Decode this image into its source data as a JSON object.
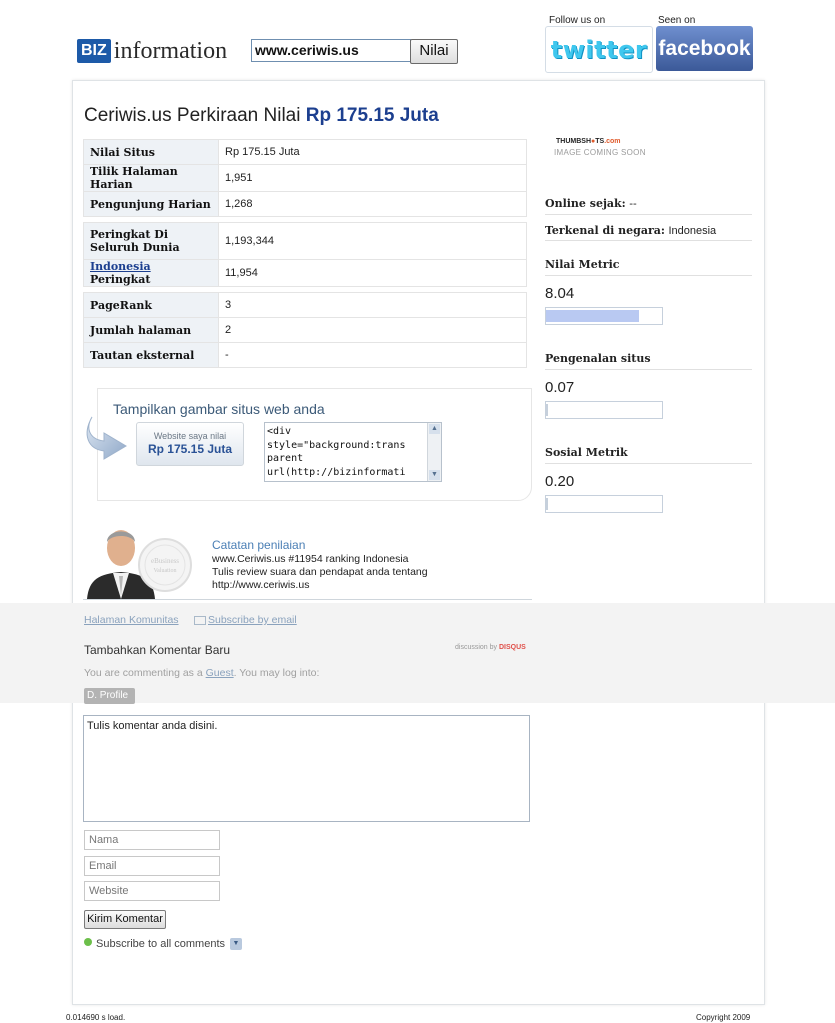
{
  "header": {
    "logo_biz": "BIZ",
    "logo_information": "information",
    "search_value": "www.ceriwis.us",
    "search_button": "Nilai",
    "follow_label": "Follow us on",
    "seen_label": "Seen on",
    "twitter": "twitter",
    "facebook": "facebook"
  },
  "title": {
    "prefix": "Ceriwis.us Perkiraan Nilai",
    "value": "Rp 175.15 Juta"
  },
  "stats": {
    "group1": [
      {
        "label": "Nilai Situs",
        "value": "Rp 175.15 Juta"
      },
      {
        "label": "Tilik Halaman Harian",
        "value": "1,951"
      },
      {
        "label": "Pengunjung Harian",
        "value": "1,268"
      }
    ],
    "group2": {
      "world_label": "Peringkat Di Seluruh Dunia",
      "world_value": "1,193,344",
      "country_link": "Indonesia",
      "country_label": "Peringkat",
      "country_value": "11,954"
    },
    "group3": [
      {
        "label": "PageRank",
        "value": "3"
      },
      {
        "label": "Jumlah halaman",
        "value": "2"
      },
      {
        "label": "Tautan eksternal",
        "value": "-"
      }
    ]
  },
  "embed": {
    "title": "Tampilkan gambar situs web anda",
    "badge_small": "Website saya nilai",
    "badge_value": "Rp 175.15 Juta",
    "code": "<div\nstyle=\"background:trans\nparent\nurl(http://bizinformati"
  },
  "valuation": {
    "seal_text": "eBusiness Valuation",
    "title": "Catatan penilaian",
    "line1": "www.Ceriwis.us #11954 ranking Indonesia",
    "line2": "Tulis review suara dan pendapat anda tentang",
    "line3": "http://www.ceriwis.us"
  },
  "comments": {
    "community_link": "Halaman Komunitas",
    "subscribe_email": "Subscribe by email",
    "add_title": "Tambahkan Komentar Baru",
    "disqus_prefix": "discussion by",
    "disqus_brand": "DISQUS",
    "guest_prefix": "You are commenting as a",
    "guest_link": "Guest",
    "guest_suffix": ". You may log into:",
    "profile_button": "D. Profile",
    "comment_placeholder": "Tulis komentar anda disini.",
    "name_placeholder": "Nama",
    "email_placeholder": "Email",
    "website_placeholder": "Website",
    "submit": "Kirim Komentar",
    "subscribe_all": "Subscribe to all comments"
  },
  "sidebar": {
    "thumb_title_a": "THUMBSH",
    "thumb_title_b": "TS",
    "thumb_title_c": ".com",
    "thumb_sub": "IMAGE COMING SOON",
    "online_label": "Online sejak:",
    "online_value": "--",
    "known_label": "Terkenal di negara:",
    "known_value": "Indonesia",
    "metrics": [
      {
        "label": "Nilai Metric",
        "value": "8.04",
        "fill_fraction": 0.804
      },
      {
        "label": "Pengenalan situs",
        "value": "0.07",
        "fill_fraction": 0.0
      },
      {
        "label": "Sosial Metrik",
        "value": "0.20",
        "fill_fraction": 0.0
      }
    ]
  },
  "footer": {
    "load_time": "0.014690 s load.",
    "copyright": "Copyright 2009"
  },
  "colors": {
    "brand_blue": "#1d5aa8",
    "title_value": "#1c3f8f",
    "twitter": "#3fc7ee",
    "facebook": "#3b5998",
    "metric_fill": "#b9c9f2"
  }
}
